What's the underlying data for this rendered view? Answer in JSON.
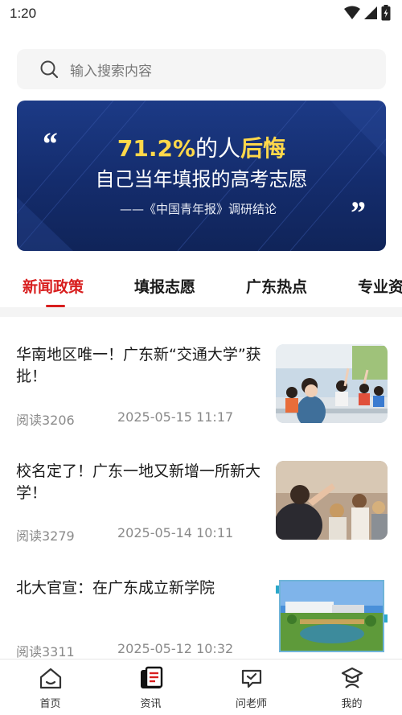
{
  "status_bar": {
    "time": "1:20",
    "icons": [
      "wifi-icon",
      "signal-icon",
      "battery-icon"
    ]
  },
  "search": {
    "placeholder": "输入搜索内容",
    "icon": "search-icon"
  },
  "banner": {
    "percent": "71.2%",
    "line1_middle": "的人",
    "line1_highlight": "后悔",
    "line2": "自己当年填报的高考志愿",
    "source": "——《中国青年报》调研结论",
    "quote_open": "“",
    "quote_close": "”"
  },
  "tabs": [
    {
      "label": "新闻政策",
      "active": true
    },
    {
      "label": "填报志愿",
      "active": false
    },
    {
      "label": "广东热点",
      "active": false
    },
    {
      "label": "专业资",
      "active": false
    }
  ],
  "news": [
    {
      "title": "华南地区唯一！广东新“交通大学”获批！",
      "reads": "阅读3206",
      "date": "2025-05-15 11:17"
    },
    {
      "title": "校名定了！广东一地又新增一所新大学！",
      "reads": "阅读3279",
      "date": "2025-05-14 10:11"
    },
    {
      "title": "北大官宣：在广东成立新学院",
      "reads": "阅读3311",
      "date": "2025-05-12 10:32"
    }
  ],
  "bottom_nav": [
    {
      "label": "首页",
      "icon": "home-icon"
    },
    {
      "label": "资讯",
      "icon": "news-icon"
    },
    {
      "label": "问老师",
      "icon": "chat-icon"
    },
    {
      "label": "我的",
      "icon": "graduate-icon"
    }
  ],
  "colors": {
    "accent": "#d81e1e",
    "banner_bg": "#1a3580",
    "highlight": "#ffd84a"
  }
}
